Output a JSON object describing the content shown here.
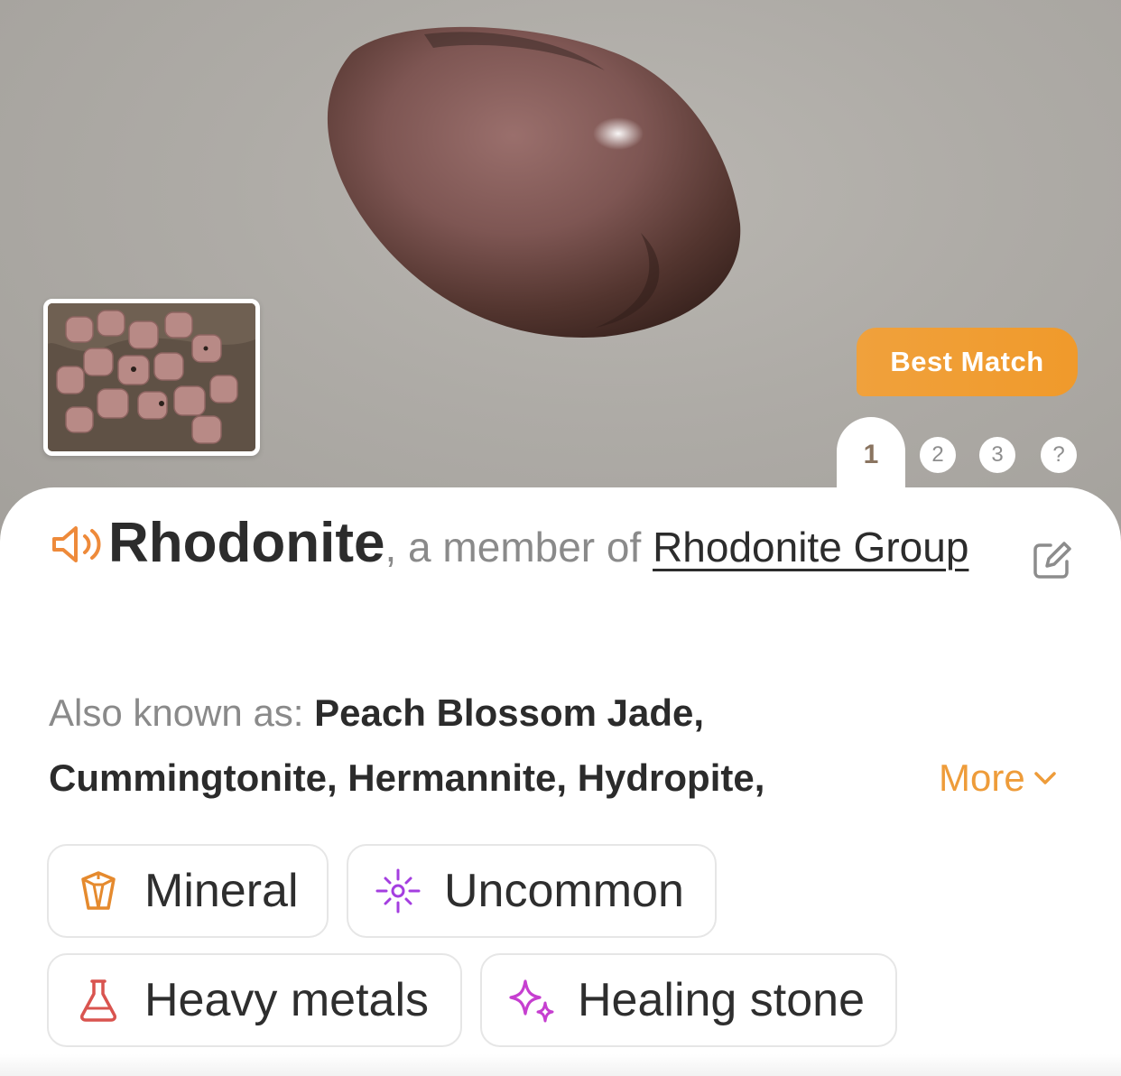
{
  "hero": {
    "best_match_label": "Best Match",
    "pages": [
      "1",
      "2",
      "3",
      "?"
    ],
    "active_page": "1"
  },
  "identification": {
    "name": "Rhodonite",
    "member_prefix": ", a member of ",
    "group_name": "Rhodonite Group"
  },
  "also_known_as": {
    "label": "Also known as: ",
    "names": "Peach Blossom Jade, Cummingtonite, Hermannite, Hydropite,",
    "more_label": "More"
  },
  "tags": [
    {
      "label": "Mineral",
      "icon": "crystal-icon",
      "color": "#e58a2e"
    },
    {
      "label": "Uncommon",
      "icon": "sparkle-burst-icon",
      "color": "#a43ee0"
    },
    {
      "label": "Heavy metals",
      "icon": "flask-icon",
      "color": "#d9544f"
    },
    {
      "label": "Healing stone",
      "icon": "sparkles-icon",
      "color": "#c63fd0"
    }
  ],
  "colors": {
    "accent_orange": "#ee9c3a",
    "text_dark": "#2c2c2c",
    "text_muted": "#8a8a8a"
  }
}
